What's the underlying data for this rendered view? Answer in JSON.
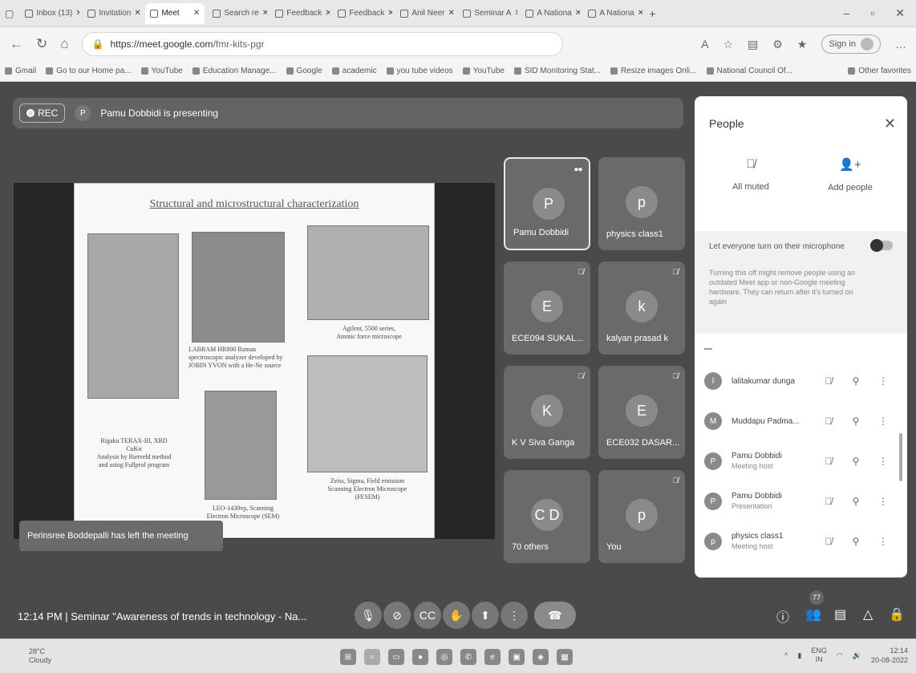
{
  "tabs": [
    {
      "label": "Inbox (13)"
    },
    {
      "label": "Invitation"
    },
    {
      "label": "Meet",
      "active": true
    },
    {
      "label": "Search re"
    },
    {
      "label": "Feedback"
    },
    {
      "label": "Feedback"
    },
    {
      "label": "Anil Neer"
    },
    {
      "label": "Seminar A"
    },
    {
      "label": "A Nationa"
    },
    {
      "label": "A Nationa"
    }
  ],
  "browser": {
    "url_host": "https://meet.google.com",
    "url_path": "/fmr-kits-pgr",
    "signin": "Sign in"
  },
  "bookmarks": [
    "Gmail",
    "Go to our Home pa...",
    "YouTube",
    "Education Manage...",
    "Google",
    "academic",
    "you tube videos",
    "YouTube",
    "SID Monitoring Stat...",
    "Resize images Onli...",
    "National Council Of...",
    "Other favorites"
  ],
  "meet": {
    "rec_label": "REC",
    "presenting_initial": "P",
    "presenting_text": "Pamu Dobbidi is presenting",
    "toast": "Perinsree Boddepalli has left the meeting",
    "meeting_info": "12:14 PM  |  Seminar \"Awareness of trends in technology - Na...",
    "people_count": "77"
  },
  "slide": {
    "title": "Structural and microstructural characterization",
    "captions": [
      "Rigaku TERAX-III, XRD\nCuKα\nAnalysis by Rietveld method\nand using Fullprof program",
      "LABRAM HR800 Raman\nspectroscopic analyzer developed by\nJOBIN YVON with a He-Ne source",
      "Agilent, 5500 series,\nAtomic force microscope",
      "Zeiss, Sigma, Field emission\nScanning Electron Microscope\n(FESEM)",
      "LEO-1430vp, Scanning\nElectron Microscope (SEM)"
    ]
  },
  "tiles": [
    {
      "initial": "P",
      "name": "Pamu Dobbidi",
      "state": "speaking"
    },
    {
      "initial": "p",
      "name": "physics class1",
      "state": ""
    },
    {
      "initial": "E",
      "name": "ECE094 SUKAL...",
      "state": "muted"
    },
    {
      "initial": "k",
      "name": "kalyan prasad k",
      "state": "muted"
    },
    {
      "initial": "K",
      "name": "K V Siva Ganga",
      "state": "muted"
    },
    {
      "initial": "E",
      "name": "ECE032 DASAR...",
      "state": "muted"
    },
    {
      "initial": "C D",
      "name": "70 others",
      "state": ""
    },
    {
      "initial": "p",
      "name": "You",
      "state": "muted"
    }
  ],
  "people": {
    "title": "People",
    "all_muted": "All muted",
    "add_people": "Add people",
    "mic_label": "Let everyone turn on their microphone",
    "mic_note": "Turning this off might remove people using an outdated Meet app or non-Google meeting hardware. They can return after it's turned on again",
    "rows": [
      {
        "initial": "l",
        "name": "lalitakumar dunga",
        "role": ""
      },
      {
        "initial": "M",
        "name": "Muddapu Padma...",
        "role": ""
      },
      {
        "initial": "P",
        "name": "Pamu Dobbidi",
        "role": "Meeting host"
      },
      {
        "initial": "P",
        "name": "Pamu Dobbidi",
        "role": "Presentation"
      },
      {
        "initial": "p",
        "name": "physics class1",
        "role": "Meeting host"
      }
    ]
  },
  "taskbar": {
    "temp": "28°C",
    "weather": "Cloudy",
    "lang": "ENG",
    "region": "IN",
    "time": "12:14",
    "date": "20-08-2022"
  }
}
